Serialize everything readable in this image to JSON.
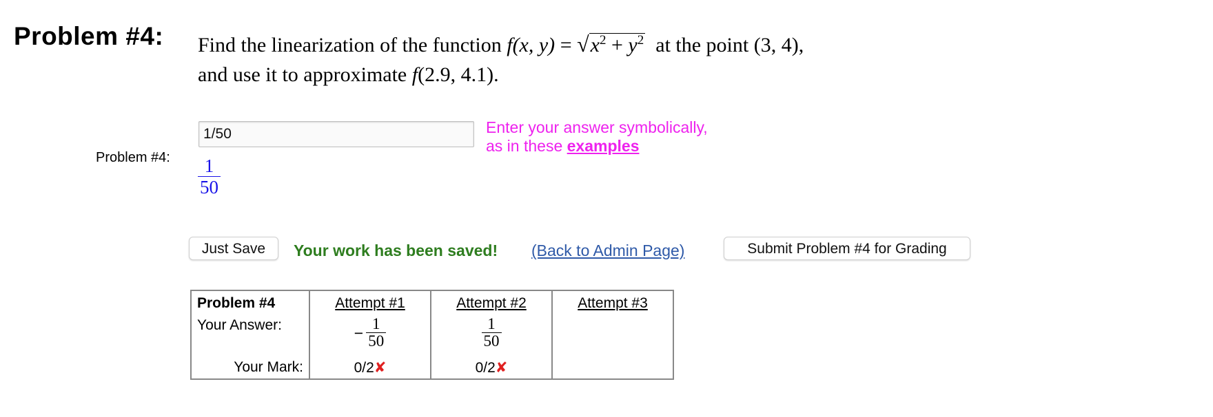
{
  "problem": {
    "heading": "Problem #4:",
    "statement": {
      "line1_prefix": "Find the linearization of the function",
      "func_name": "f",
      "func_args": "(x, y)",
      "equals": "=",
      "sqrt_symbol": "√",
      "radicand_x": "x",
      "radicand_y": "y",
      "exponent": "2",
      "plus": " + ",
      "line1_suffix": "at the point (3, 4),",
      "line2_prefix": "and use it to approximate",
      "line2_func": "f",
      "line2_args": "(2.9, 4.1)."
    }
  },
  "answer": {
    "side_label": "Problem #4:",
    "input_value": "1/50",
    "hint_line1": "Enter your answer symbolically,",
    "hint_line2_prefix": "as in these",
    "hint_link": "examples",
    "preview_num": "1",
    "preview_den": "50"
  },
  "actions": {
    "just_save": "Just Save",
    "saved_message": "Your work has been saved!",
    "admin_link": "(Back to Admin Page)",
    "submit": "Submit Problem #4 for Grading"
  },
  "attempts_table": {
    "header": [
      "Problem #4",
      "Attempt #1",
      "Attempt #2",
      "Attempt #3"
    ],
    "answer_label": "Your Answer:",
    "mark_label": "Your Mark:",
    "attempt1": {
      "sign": "−",
      "num": "1",
      "den": "50",
      "mark": "0/2",
      "mark_icon": "✘"
    },
    "attempt2": {
      "num": "1",
      "den": "50",
      "mark": "0/2",
      "mark_icon": "✘"
    }
  },
  "colors": {
    "hint": "#ee22ee",
    "preview": "#1a14e8",
    "saved": "#2e7d1f",
    "link": "#2f5aa8",
    "wrong": "#e02020"
  }
}
